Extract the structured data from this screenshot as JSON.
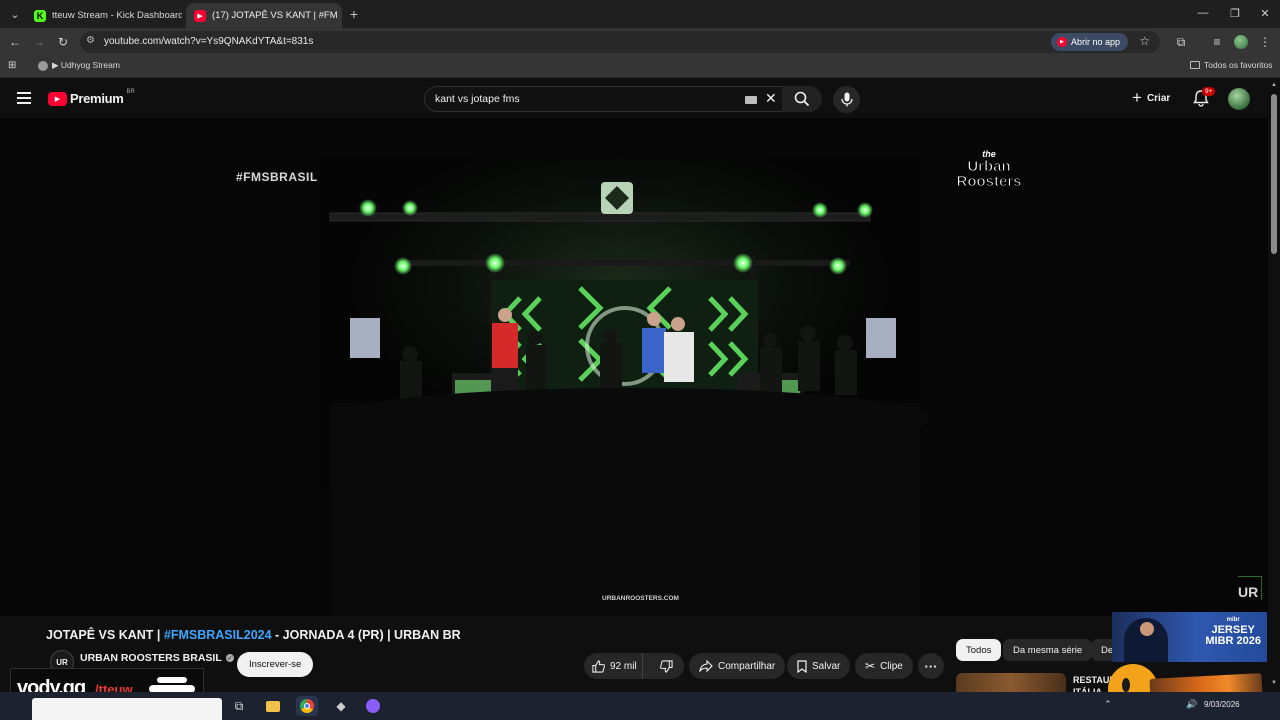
{
  "browser": {
    "tabs": [
      {
        "title": "tteuw Stream - Kick Dashboard",
        "icon": "kick-icon"
      },
      {
        "title": "(17) JOTAPÊ VS KANT | #FM",
        "icon": "youtube-icon"
      }
    ],
    "url": "youtube.com/watch?v=Ys9QNAKdYTA&t=831s",
    "open_app_label": "Abrir no app",
    "bookmark_item": "▶ Udhyog Stream",
    "all_bookmarks_label": "Todos os favoritos"
  },
  "youtube": {
    "logo_text": "Premium",
    "region_badge": "BR",
    "search_query": "kant vs jotape fms",
    "create_label": "Criar",
    "notification_count": "9+"
  },
  "video": {
    "overlay_hashtag": "#FMSBRASIL",
    "logo_text_the": "the",
    "logo_text_brand_1": "Urban",
    "logo_text_brand_2": "Roosters",
    "footer_url": "URBANROOSTERS.COM",
    "corner_badge": "UR",
    "title_part1": "JOTAPÊ VS KANT | ",
    "title_hashtag": "#FMSBRASIL2024",
    "title_part2": " - JORNADA 4 (PR) | URBAN BR"
  },
  "channel": {
    "name": "URBAN ROOSTERS BRASIL",
    "avatar_text": "UR",
    "subscribe_label": "Inscrever-se"
  },
  "actions": {
    "likes": "92 mil",
    "share": "Compartilhar",
    "save": "Salvar",
    "clip": "Clipe"
  },
  "chips": [
    "Todos",
    "Da mesma série",
    "De"
  ],
  "recommendation": {
    "title_line1": "RESTAUR",
    "title_line2": "ITÁLIA"
  },
  "promo": {
    "line1": "JERSEY",
    "line2": "MIBR 2026",
    "brand": "mibr"
  },
  "overlay_brand": {
    "text1": "vody.gg",
    "text2": "/tteuw"
  },
  "system": {
    "date": "9/03/2026"
  },
  "colors": {
    "youtube_red": "#ff0033",
    "link_blue": "#3ea6ff",
    "stage_green": "#6dff6d",
    "kick_green": "#53fc18"
  }
}
